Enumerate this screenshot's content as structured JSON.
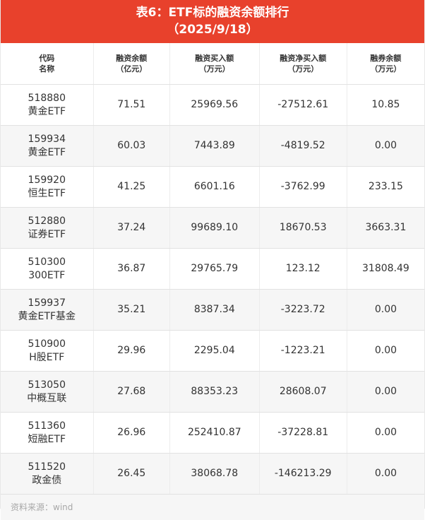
{
  "title": {
    "line1": "表6：ETF标的融资余额排行",
    "line2": "（2025/9/18）"
  },
  "headers": [
    {
      "line1": "代码",
      "line2": "名称"
    },
    {
      "line1": "融资余额",
      "line2": "（亿元）"
    },
    {
      "line1": "融资买入额",
      "line2": "（万元）"
    },
    {
      "line1": "融资净买入额",
      "line2": "（万元）"
    },
    {
      "line1": "融券余额",
      "line2": "（万元）"
    }
  ],
  "rows": [
    {
      "code": "518880",
      "name": "黄金ETF",
      "margin_balance": "71.51",
      "margin_buy": "25969.56",
      "net_buy": "-27512.61",
      "short_balance": "10.85"
    },
    {
      "code": "159934",
      "name": "黄金ETF",
      "margin_balance": "60.03",
      "margin_buy": "7443.89",
      "net_buy": "-4819.52",
      "short_balance": "0.00"
    },
    {
      "code": "159920",
      "name": "恒生ETF",
      "margin_balance": "41.25",
      "margin_buy": "6601.16",
      "net_buy": "-3762.99",
      "short_balance": "233.15"
    },
    {
      "code": "512880",
      "name": "证券ETF",
      "margin_balance": "37.24",
      "margin_buy": "99689.10",
      "net_buy": "18670.53",
      "short_balance": "3663.31"
    },
    {
      "code": "510300",
      "name": "300ETF",
      "margin_balance": "36.87",
      "margin_buy": "29765.79",
      "net_buy": "123.12",
      "short_balance": "31808.49"
    },
    {
      "code": "159937",
      "name": "黄金ETF基金",
      "margin_balance": "35.21",
      "margin_buy": "8387.34",
      "net_buy": "-3223.72",
      "short_balance": "0.00"
    },
    {
      "code": "510900",
      "name": "H股ETF",
      "margin_balance": "29.96",
      "margin_buy": "2295.04",
      "net_buy": "-1223.21",
      "short_balance": "0.00"
    },
    {
      "code": "513050",
      "name": "中概互联",
      "margin_balance": "27.68",
      "margin_buy": "88353.23",
      "net_buy": "28608.07",
      "short_balance": "0.00"
    },
    {
      "code": "511360",
      "name": "短融ETF",
      "margin_balance": "26.96",
      "margin_buy": "252410.87",
      "net_buy": "-37228.81",
      "short_balance": "0.00"
    },
    {
      "code": "511520",
      "name": "政金债",
      "margin_balance": "26.45",
      "margin_buy": "38068.78",
      "net_buy": "-146213.29",
      "short_balance": "0.00"
    }
  ],
  "footer": {
    "source": "资料来源：wind"
  },
  "colors": {
    "title_bg": "#e8412c",
    "title_text": "#ffffff",
    "stripe": "#f6f6f6"
  }
}
